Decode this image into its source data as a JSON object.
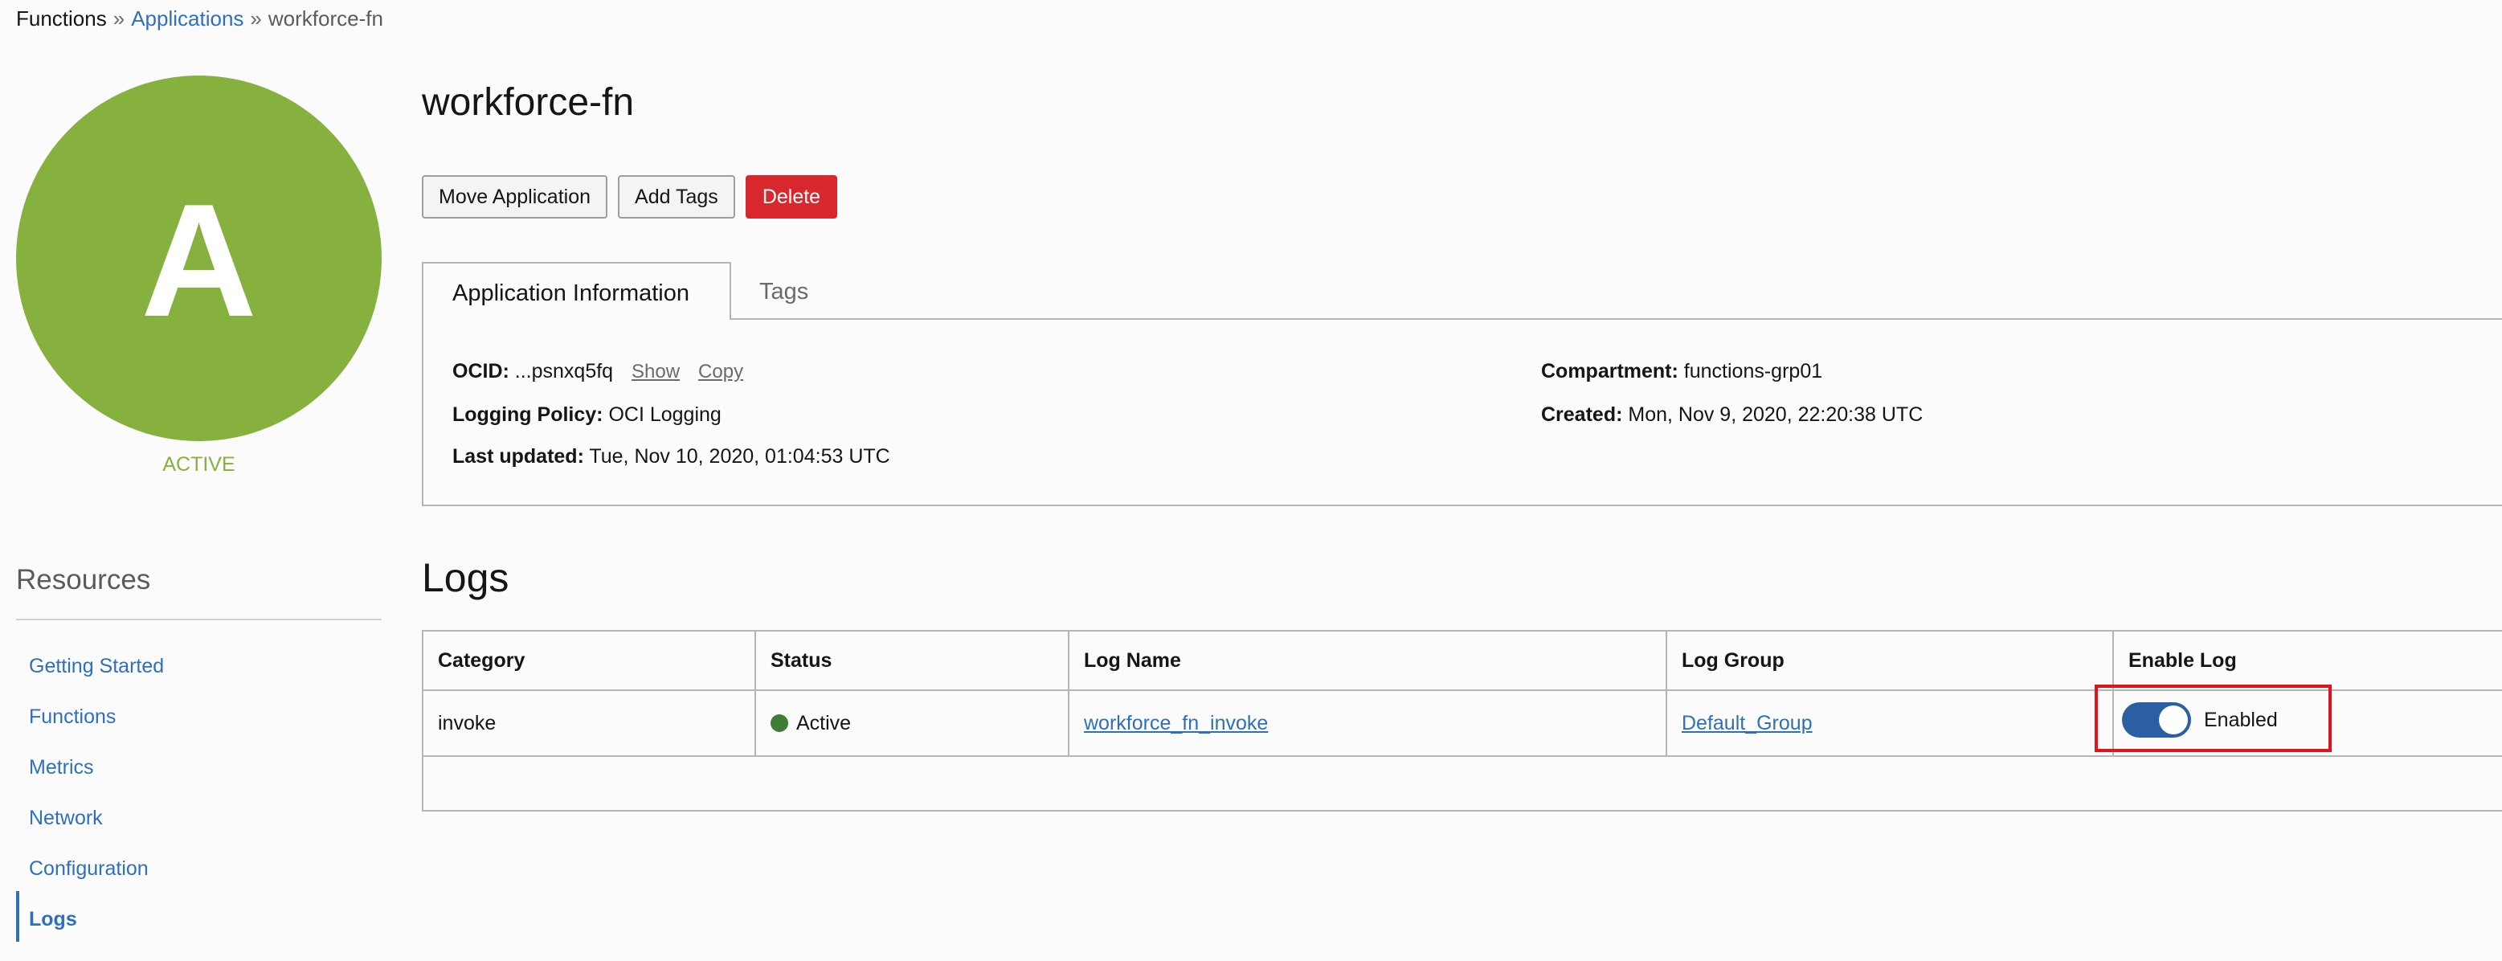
{
  "breadcrumb": {
    "root": "Functions",
    "separator": "»",
    "parent": "Applications",
    "current": "workforce-fn"
  },
  "avatar": {
    "letter": "A",
    "color": "#87b13e",
    "state": "ACTIVE"
  },
  "page_title": "workforce-fn",
  "actions": {
    "move": "Move Application",
    "add_tags": "Add Tags",
    "delete": "Delete"
  },
  "tabs": [
    {
      "label": "Application Information",
      "active": true
    },
    {
      "label": "Tags",
      "active": false
    }
  ],
  "info": {
    "ocid_label": "OCID:",
    "ocid_value": "...psnxq5fq",
    "show": "Show",
    "copy": "Copy",
    "logging_label": "Logging Policy:",
    "logging_value": "OCI Logging",
    "updated_label": "Last updated:",
    "updated_value": "Tue, Nov 10, 2020, 01:04:53 UTC",
    "compartment_label": "Compartment:",
    "compartment_value": "functions-grp01",
    "created_label": "Created:",
    "created_value": "Mon, Nov 9, 2020, 22:20:38 UTC"
  },
  "resources": {
    "title": "Resources",
    "items": [
      {
        "label": "Getting Started"
      },
      {
        "label": "Functions"
      },
      {
        "label": "Metrics"
      },
      {
        "label": "Network"
      },
      {
        "label": "Configuration"
      },
      {
        "label": "Logs",
        "active": true
      }
    ]
  },
  "logs": {
    "title": "Logs",
    "columns": [
      "Category",
      "Status",
      "Log Name",
      "Log Group",
      "Enable Log"
    ],
    "rows": [
      {
        "category": "invoke",
        "status": "Active",
        "log_name": "workforce_fn_invoke",
        "log_group": "Default_Group",
        "enable_label": "Enabled",
        "enabled": true
      }
    ]
  },
  "colors": {
    "accent": "#2e70b9",
    "danger": "#d9272e",
    "active_green": "#87b13e",
    "status_dot": "#3f7e36",
    "toggle_on": "#2b5fa3",
    "highlight": "#e0121c"
  }
}
